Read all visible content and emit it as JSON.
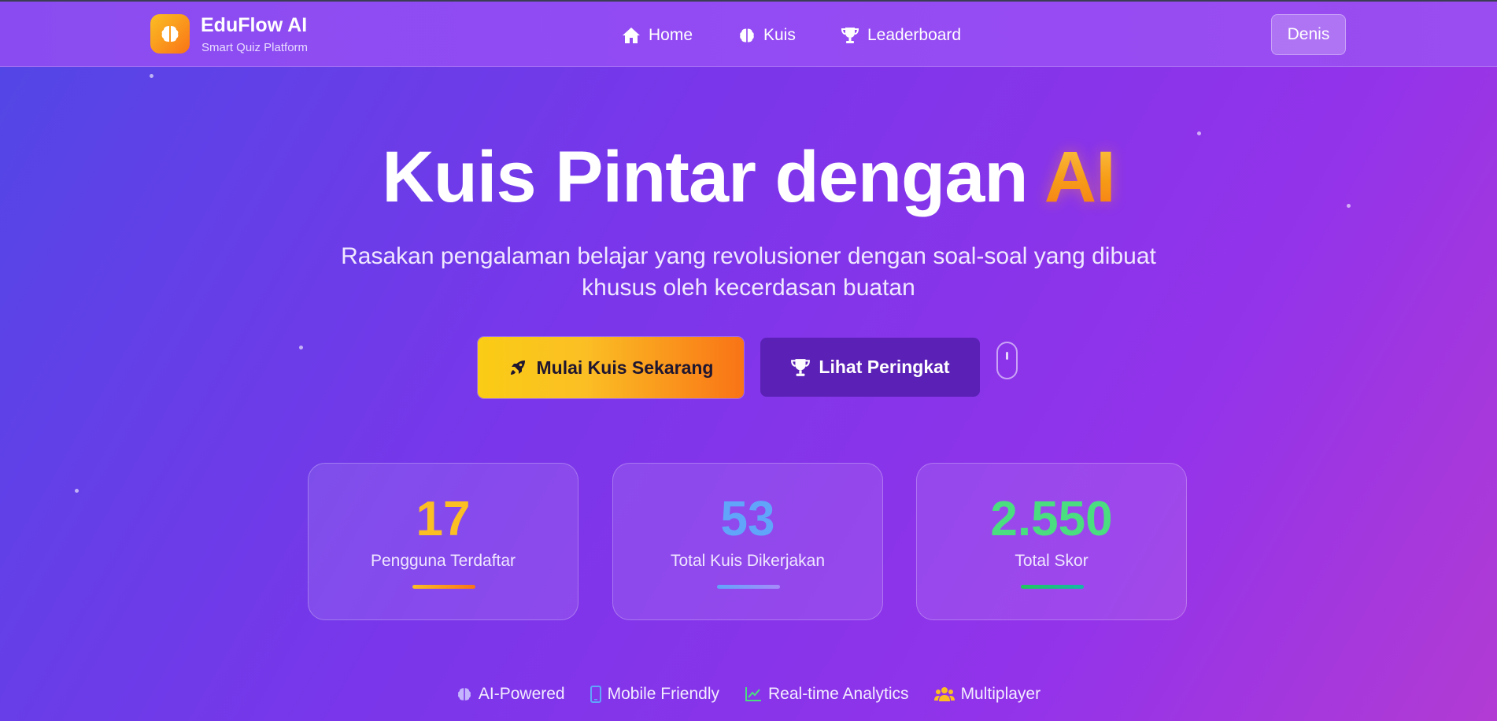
{
  "header": {
    "brand_title": "EduFlow AI",
    "brand_subtitle": "Smart Quiz Platform",
    "logo_icon": "brain-icon",
    "nav": [
      {
        "label": "Home",
        "icon": "home-icon"
      },
      {
        "label": "Kuis",
        "icon": "brain-icon"
      },
      {
        "label": "Leaderboard",
        "icon": "trophy-icon"
      }
    ],
    "user_name": "Denis"
  },
  "hero": {
    "title_main": "Kuis Pintar dengan ",
    "title_accent": "AI",
    "subtitle_line1": "Rasakan pengalaman belajar yang revolusioner dengan soal-soal yang dibuat",
    "subtitle_line2": "khusus oleh kecerdasan buatan",
    "primary_button": {
      "label": "Mulai Kuis Sekarang",
      "icon": "rocket-icon"
    },
    "secondary_button": {
      "label": "Lihat Peringkat",
      "icon": "trophy-icon"
    },
    "scroll_icon": "mouse-scroll-icon"
  },
  "stats": [
    {
      "value": "17",
      "label": "Pengguna Terdaftar",
      "color": "#fbbf24",
      "bar_from": "#fbbf24",
      "bar_to": "#f97316"
    },
    {
      "value": "53",
      "label": "Total Kuis Dikerjakan",
      "color": "#60a5fa",
      "bar_from": "#60a5fa",
      "bar_to": "#a78bfa"
    },
    {
      "value": "2.550",
      "label": "Total Skor",
      "color": "#4ade80",
      "bar_from": "#22c55e",
      "bar_to": "#14b8a6"
    }
  ],
  "features": [
    {
      "label": "AI-Powered",
      "icon": "brain-icon",
      "color": "#c4b5fd"
    },
    {
      "label": "Mobile Friendly",
      "icon": "mobile-icon",
      "color": "#60a5fa"
    },
    {
      "label": "Real-time Analytics",
      "icon": "chart-line-icon",
      "color": "#4ade80"
    },
    {
      "label": "Multiplayer",
      "icon": "users-icon",
      "color": "#fbbf24"
    }
  ],
  "colors": {
    "accent_yellow": "#fbbf24",
    "accent_orange": "#f97316",
    "secondary_button": "#5b21b6"
  }
}
